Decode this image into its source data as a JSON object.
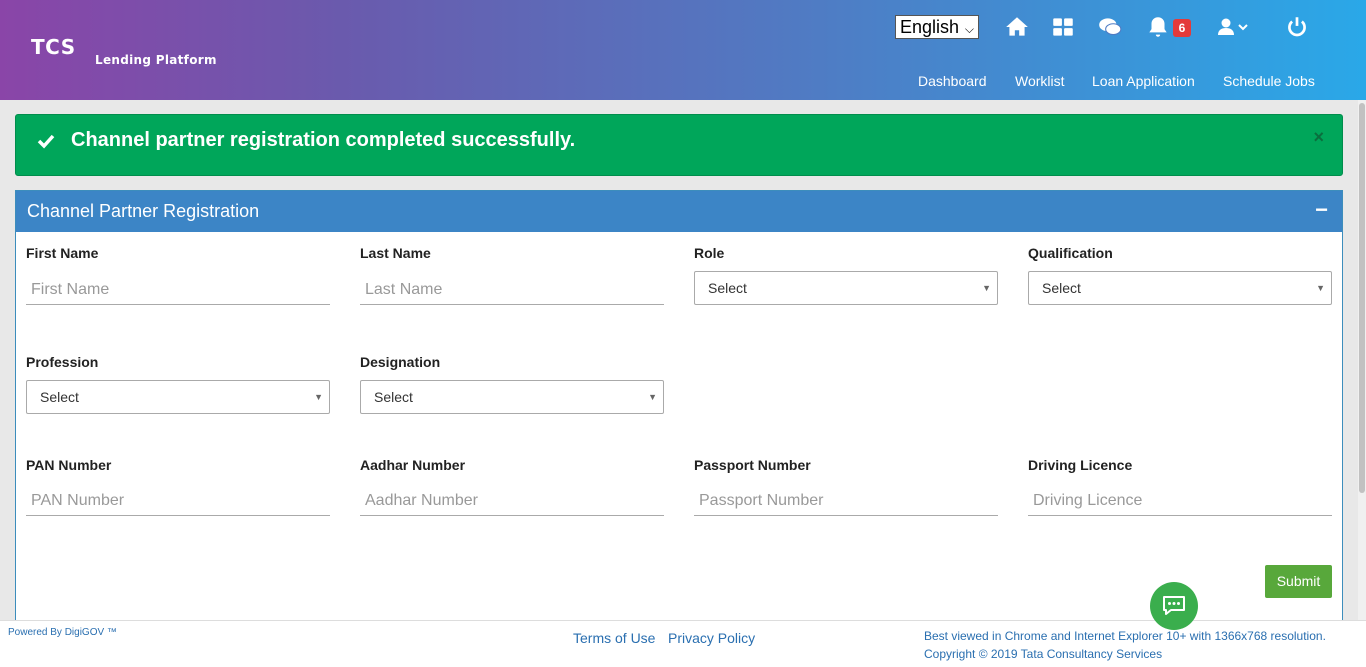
{
  "header": {
    "logo_main": "TCS",
    "logo_sub": "Lending Platform",
    "language": "English",
    "notification_count": "6",
    "nav": [
      "Dashboard",
      "Worklist",
      "Loan Application",
      "Schedule Jobs"
    ]
  },
  "alert": {
    "message": "Channel partner registration completed successfully.",
    "close": "×"
  },
  "form": {
    "title": "Channel Partner Registration",
    "collapse": "−",
    "first_name_label": "First Name",
    "first_name_placeholder": "First Name",
    "last_name_label": "Last Name",
    "last_name_placeholder": "Last Name",
    "role_label": "Role",
    "role_value": "Select",
    "qualification_label": "Qualification",
    "qualification_value": "Select",
    "profession_label": "Profession",
    "profession_value": "Select",
    "designation_label": "Designation",
    "designation_value": "Select",
    "pan_label": "PAN Number",
    "pan_placeholder": "PAN Number",
    "aadhar_label": "Aadhar Number",
    "aadhar_placeholder": "Aadhar Number",
    "passport_label": "Passport Number",
    "passport_placeholder": "Passport Number",
    "licence_label": "Driving Licence",
    "licence_placeholder": "Driving Licence",
    "submit": "Submit"
  },
  "footer": {
    "powered": "Powered By DigiGOV ™",
    "terms": "Terms of Use",
    "privacy": "Privacy Policy",
    "best_viewed": "Best viewed in Chrome and Internet Explorer 10+ with 1366x768 resolution.",
    "copyright": "Copyright © 2019 Tata Consultancy Services"
  },
  "colors": {
    "alert": "#00a65a",
    "box_header": "#3c85c6",
    "submit": "#58a83b",
    "badge": "#e43a3a"
  }
}
